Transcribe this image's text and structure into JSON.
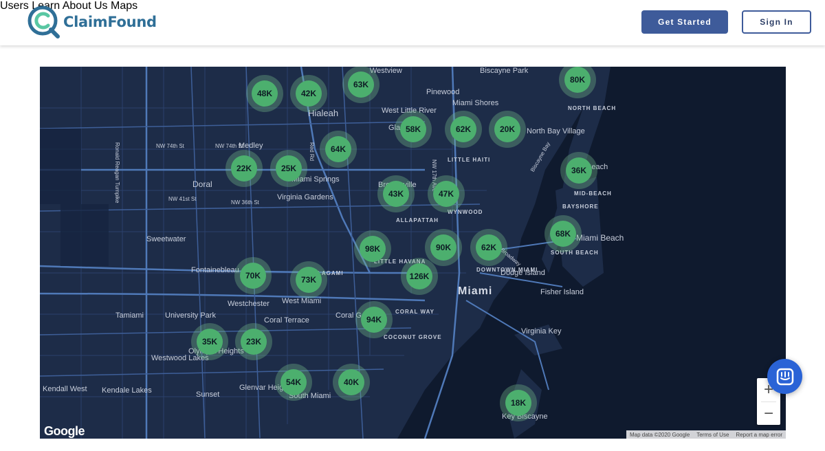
{
  "brand": {
    "name": "ClaimFound"
  },
  "nav": {
    "items": [
      "Users",
      "Learn",
      "About Us",
      "Maps"
    ],
    "get_started": "Get Started",
    "sign_in": "Sign In"
  },
  "colors": {
    "accent": "#3e5b9a",
    "brand": "#2f6f97",
    "cluster": "#4caf6e",
    "map_bg": "#1d2c48",
    "chat": "#2a63d6"
  },
  "map": {
    "clusters": [
      "48K",
      "42K",
      "63K",
      "80K",
      "58K",
      "62K",
      "20K",
      "22K",
      "25K",
      "64K",
      "36K",
      "43K",
      "47K",
      "98K",
      "90K",
      "62K",
      "68K",
      "70K",
      "73K",
      "126K",
      "94K",
      "35K",
      "23K",
      "54K",
      "40K",
      "18K"
    ],
    "places": [
      "Hialeah",
      "Miami Shores",
      "Pinewood",
      "West Little River",
      "Gladeview",
      "North Bay Village",
      "Medley",
      "Miami Springs",
      "Doral",
      "Virginia Gardens",
      "Brownsville",
      "Sweetwater",
      "Fontainebleau",
      "Westchester",
      "West Miami",
      "Coral Gables",
      "Coral Terrace",
      "Tamiami",
      "University Park",
      "Olympia Heights",
      "Westwood Lakes",
      "Kendall West",
      "Kendale Lakes",
      "Sunset",
      "Glenvar Heights",
      "South Miami",
      "Miami",
      "Dodge Island",
      "Fisher Island",
      "Virginia Key",
      "Key Biscayne",
      "Biscayne Park",
      "Westview",
      "Beach",
      "Miami Beach"
    ],
    "neighborhoods": [
      "NORTH BEACH",
      "LITTLE HAITI",
      "MID-BEACH",
      "BAYSHORE",
      "WYNWOOD",
      "ALLAPATTAH",
      "LITTLE HAVANA",
      "DOWNTOWN MIAMI",
      "SOUTH BEACH",
      "COCONUT GROVE",
      "CORAL WAY",
      "LAGAMI"
    ],
    "roads": [
      "NW 74th St",
      "NW 74th St",
      "NW 41st St",
      "NW 36th St",
      "Ronald Reagan Turnpike",
      "Red Rd",
      "NW 17th Ave",
      "Biscayne Bay",
      "Broadway"
    ],
    "zoom_in": "+",
    "zoom_out": "−",
    "google": "Google",
    "attribution": [
      "Map data ©2020 Google",
      "Terms of Use",
      "Report a map error"
    ]
  }
}
